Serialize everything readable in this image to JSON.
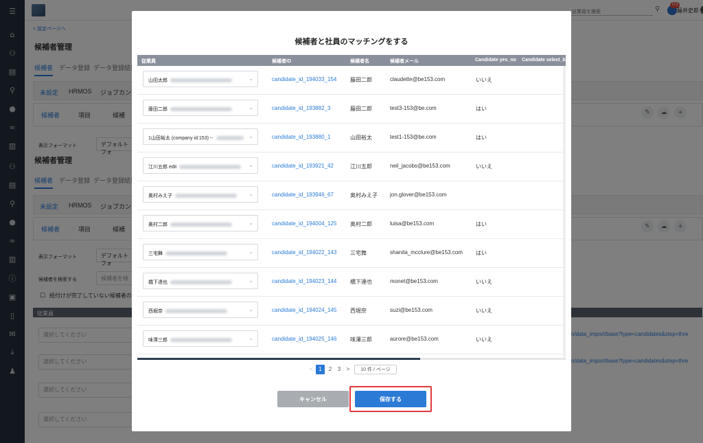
{
  "topbar": {
    "search_placeholder": "従業員を検索",
    "notif_count": "101",
    "user_name": "藤井史郎"
  },
  "background": {
    "back_link": "< 設定ページへ",
    "section_title": "候補者管理",
    "tabs": [
      "候補者",
      "データ登録",
      "データ登録結果"
    ],
    "subtabs": [
      "未設定",
      "HRMOS",
      "ジョブカン"
    ],
    "view_tabs": [
      "候補者",
      "項目",
      "候補"
    ],
    "format_label": "表示フォーマット",
    "format_value": "デフォルトフォ",
    "search_label": "候補者を検索する",
    "search_placeholder": "候補者を検",
    "checkbox_label": "紐付けが完了していない候補者の",
    "table_header": "従業員",
    "select_placeholder": "選択してください",
    "link_text_1": "n/data_import/base?type=candidates&step=thre",
    "link_text_2": "n/data_import/base?type=candidates&step=thre"
  },
  "modal": {
    "title": "候補者と社員のマッチングをする",
    "columns": [
      "従業員",
      "候補者ID",
      "候補者名",
      "候補者メール",
      "Candidate yes_no",
      "Candidate select_b"
    ],
    "rows": [
      {
        "employee": "山田太郎",
        "id": "candidate_id_194033_154",
        "name": "藤田二郎",
        "email": "claudette@be153.com",
        "yes_no": "いいえ"
      },
      {
        "employee": "藤田二郎",
        "id": "candidate_id_193882_3",
        "name": "藤田二郎",
        "email": "test3-153@be.com",
        "yes_no": "はい"
      },
      {
        "employee": "1山田裕太 (company id:153) --",
        "id": "candidate_id_193880_1",
        "name": "山田裕太",
        "email": "test1-153@be.com",
        "yes_no": "はい"
      },
      {
        "employee": "江川五郎 edit",
        "id": "candidate_id_193921_42",
        "name": "江川五郎",
        "email": "neil_jacobs@be153.com",
        "yes_no": "いいえ"
      },
      {
        "employee": "奥村みえ子",
        "id": "candidate_id_193946_67",
        "name": "奥村みえ子",
        "email": "jon.glover@be153.com",
        "yes_no": ""
      },
      {
        "employee": "奥村二郎",
        "id": "candidate_id_194004_125",
        "name": "奥村二郎",
        "email": "luisa@be153.com",
        "yes_no": "はい"
      },
      {
        "employee": "三宅舞",
        "id": "candidate_id_194022_143",
        "name": "三宅舞",
        "email": "shanita_mcclure@be153.com",
        "yes_no": "はい"
      },
      {
        "employee": "橋下達也",
        "id": "candidate_id_194023_144",
        "name": "橋下達也",
        "email": "monet@be153.com",
        "yes_no": "いいえ"
      },
      {
        "employee": "西堀奈",
        "id": "candidate_id_194024_145",
        "name": "西堀奈",
        "email": "suzi@be153.com",
        "yes_no": "いいえ"
      },
      {
        "employee": "味澤三郎",
        "id": "candidate_id_194025_146",
        "name": "味澤三郎",
        "email": "aurore@be153.com",
        "yes_no": "いいえ"
      }
    ],
    "pagination": {
      "prev": "<",
      "pages": [
        "1",
        "2",
        "3"
      ],
      "next": ">",
      "page_size": "10 件 / ページ"
    },
    "cancel_label": "キャンセル",
    "save_label": "保存する"
  }
}
